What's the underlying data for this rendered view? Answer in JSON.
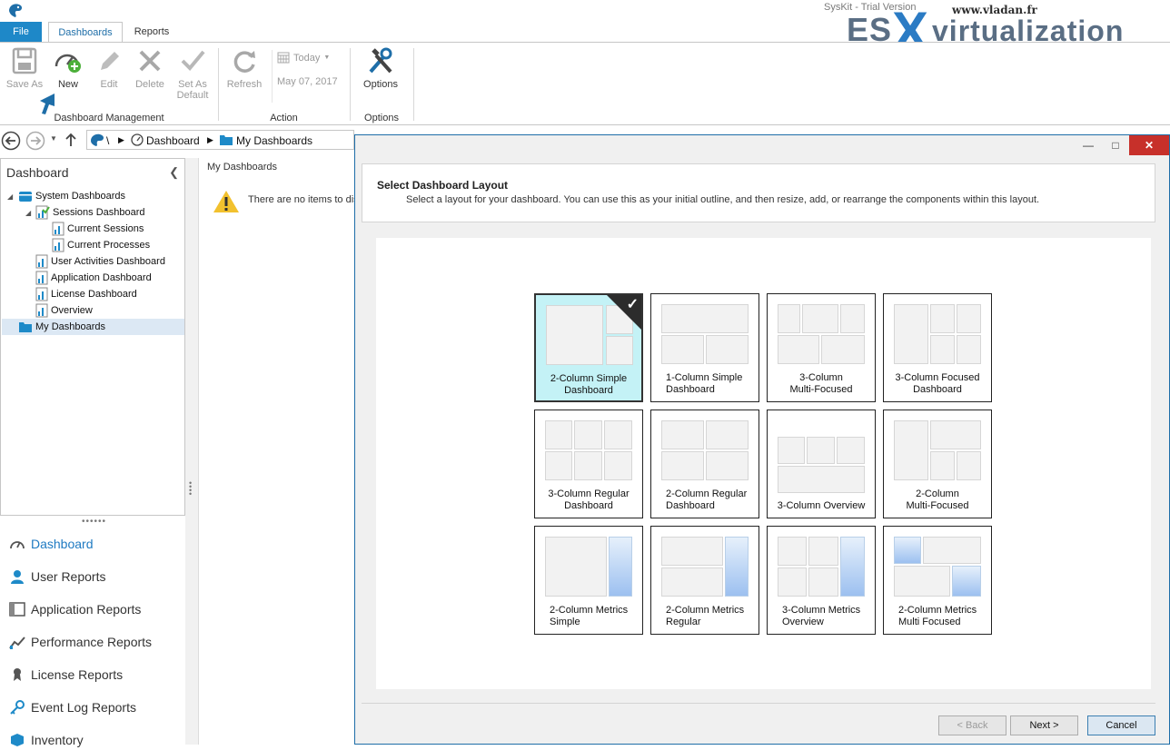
{
  "window": {
    "title": "SysKit - Trial Version"
  },
  "watermark": {
    "url": "www.vladan.fr",
    "es": "ES",
    "x": "X",
    "rest": "virtualization"
  },
  "tabs": [
    {
      "label": "File"
    },
    {
      "label": "Dashboards"
    },
    {
      "label": "Reports"
    }
  ],
  "ribbon": {
    "dashboard_management": {
      "group_label": "Dashboard Management",
      "save_as": "Save As",
      "new": "New",
      "edit": "Edit",
      "delete": "Delete",
      "set_as_default_line1": "Set As",
      "set_as_default_line2": "Default"
    },
    "action": {
      "group_label": "Action",
      "refresh": "Refresh",
      "today": "Today",
      "date": "May 07, 2017"
    },
    "options": {
      "group_label": "Options",
      "options": "Options"
    }
  },
  "breadcrumb": {
    "root": "\\",
    "dashboard": "Dashboard",
    "my_dashboards": "My Dashboards"
  },
  "sidebar": {
    "title": "Dashboard",
    "tree": [
      {
        "label": "System Dashboards"
      },
      {
        "label": "Sessions Dashboard"
      },
      {
        "label": "Current Sessions"
      },
      {
        "label": "Current Processes"
      },
      {
        "label": "User Activities Dashboard"
      },
      {
        "label": "Application Dashboard"
      },
      {
        "label": "License Dashboard"
      },
      {
        "label": "Overview"
      },
      {
        "label": "My Dashboards"
      }
    ],
    "nav": [
      {
        "label": "Dashboard",
        "icon": "dashboard-gauge-icon"
      },
      {
        "label": "User Reports",
        "icon": "user-icon"
      },
      {
        "label": "Application Reports",
        "icon": "application-icon"
      },
      {
        "label": "Performance Reports",
        "icon": "performance-chart-icon"
      },
      {
        "label": "License Reports",
        "icon": "license-icon"
      },
      {
        "label": "Event Log Reports",
        "icon": "key-icon"
      },
      {
        "label": "Inventory",
        "icon": "inventory-icon"
      }
    ]
  },
  "content": {
    "title": "My Dashboards",
    "empty_message": "There are no items to dis"
  },
  "dialog": {
    "title": "Select Dashboard Layout",
    "subtitle": "Select a layout for your dashboard. You can use this as your initial outline, and then resize, add, or rearrange the components within this layout.",
    "layouts": [
      {
        "line1": "2-Column Simple",
        "line2": "Dashboard"
      },
      {
        "line1": "1-Column Simple",
        "line2": "Dashboard"
      },
      {
        "line1": "3-Column",
        "line2": "Multi-Focused"
      },
      {
        "line1": "3-Column Focused",
        "line2": "Dashboard"
      },
      {
        "line1": "3-Column Regular",
        "line2": "Dashboard"
      },
      {
        "line1": "2-Column Regular",
        "line2": "Dashboard"
      },
      {
        "line1": "3-Column Overview",
        "line2": ""
      },
      {
        "line1": "2-Column",
        "line2": "Multi-Focused"
      },
      {
        "line1": "2-Column Metrics",
        "line2": "Simple"
      },
      {
        "line1": "2-Column Metrics",
        "line2": "Regular"
      },
      {
        "line1": "3-Column Metrics",
        "line2": "Overview"
      },
      {
        "line1": "2-Column Metrics",
        "line2": "Multi Focused"
      }
    ],
    "selected_layout": "2-Column Simple Dashboard",
    "buttons": {
      "back": "< Back",
      "next": "Next >",
      "cancel": "Cancel"
    }
  },
  "colors": {
    "accent": "#1e88c8",
    "selected_tile": "#c4f2f6",
    "close_button": "#c7302a"
  }
}
